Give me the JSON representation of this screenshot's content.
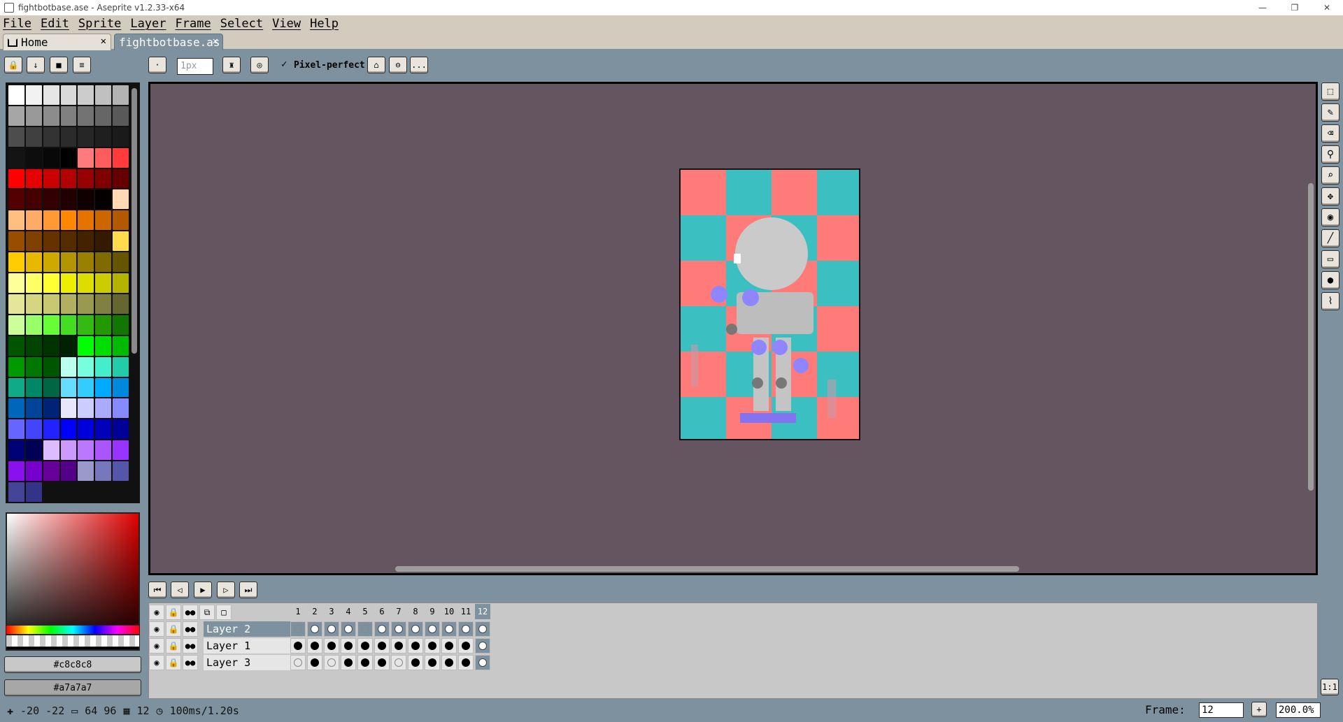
{
  "window": {
    "title": "fightbotbase.ase - Aseprite v1.2.33-x64",
    "minimize": "—",
    "restore": "❐",
    "close": "✕"
  },
  "menu": [
    "File",
    "Edit",
    "Sprite",
    "Layer",
    "Frame",
    "Select",
    "View",
    "Help"
  ],
  "tabs": {
    "home": {
      "label": "Home",
      "close": "✕"
    },
    "file": {
      "label": "fightbotbase.as",
      "close": "✕"
    }
  },
  "context_bar": {
    "brush_size": "1px",
    "pixel_perfect_label": "Pixel-perfect",
    "more": "..."
  },
  "palette": {
    "colors": [
      "#ffffff",
      "#f2f2f2",
      "#e6e6e6",
      "#d9d9d9",
      "#cccccc",
      "#c0c0c0",
      "#b3b3b3",
      "#a6a6a6",
      "#999999",
      "#8c8c8c",
      "#808080",
      "#737373",
      "#666666",
      "#595959",
      "#4d4d4d",
      "#404040",
      "#333333",
      "#2b2b2b",
      "#262626",
      "#1f1f1f",
      "#1a1a1a",
      "#141414",
      "#0d0d0d",
      "#080808",
      "#000000",
      "#ff7b7b",
      "#ff5c5c",
      "#ff3b3b",
      "#ff0000",
      "#e60000",
      "#cc0000",
      "#b30000",
      "#990000",
      "#800000",
      "#660000",
      "#550000",
      "#440000",
      "#330000",
      "#220000",
      "#110000",
      "#050000",
      "#ffd9b3",
      "#ffbf80",
      "#ffaa66",
      "#ff9933",
      "#ff8800",
      "#e67300",
      "#cc6600",
      "#b35900",
      "#994d00",
      "#804000",
      "#663300",
      "#552b00",
      "#442200",
      "#331a00",
      "#ffdb4d",
      "#ffcc00",
      "#e6b800",
      "#ccaa00",
      "#b39500",
      "#998000",
      "#806b00",
      "#665500",
      "#ffff99",
      "#ffff66",
      "#ffff33",
      "#eeee00",
      "#dddd00",
      "#cccc00",
      "#b3b300",
      "#e6e699",
      "#d6d680",
      "#c8c873",
      "#b0b060",
      "#999950",
      "#808040",
      "#666630",
      "#ccff99",
      "#99ff66",
      "#66ff33",
      "#44dd22",
      "#33bb11",
      "#229900",
      "#117700",
      "#005500",
      "#004400",
      "#003300",
      "#002200",
      "#00ff00",
      "#00dd00",
      "#00bb00",
      "#009900",
      "#007700",
      "#005500",
      "#bbffee",
      "#77ffdd",
      "#44eecc",
      "#22ccaa",
      "#11aa88",
      "#008866",
      "#006644",
      "#66ddff",
      "#33ccff",
      "#00aaff",
      "#0088dd",
      "#0066bb",
      "#004499",
      "#002277",
      "#e6e6ff",
      "#ccccff",
      "#aaaaff",
      "#8888ff",
      "#6666ff",
      "#4444ff",
      "#2222ff",
      "#0000ff",
      "#0000dd",
      "#0000bb",
      "#000099",
      "#000077",
      "#000055",
      "#ddbbff",
      "#cc99ff",
      "#bb77ff",
      "#aa55ff",
      "#9933ff",
      "#8811ee",
      "#7700cc",
      "#660099",
      "#550088",
      "#9999cc",
      "#7777bb",
      "#5555aa",
      "#444499",
      "#333388"
    ]
  },
  "colors": {
    "foreground": "#c8c8c8",
    "background": "#a7a7a7",
    "canvas_bg": "#655561",
    "checker_a": "#fe7b7a",
    "checker_b": "#3cbfc0"
  },
  "tools": [
    "marquee-icon",
    "pencil-icon",
    "eraser-icon",
    "eyedropper-icon",
    "zoom-icon",
    "move-icon",
    "bucket-icon",
    "line-icon",
    "rectangle-icon",
    "blur-icon",
    "brush-icon"
  ],
  "timeline": {
    "frames": [
      "1",
      "2",
      "3",
      "4",
      "5",
      "6",
      "7",
      "8",
      "9",
      "10",
      "11",
      "12"
    ],
    "current_frame": 12,
    "layers": [
      {
        "name": "Layer 2",
        "cels": [
          "hollow",
          "empty",
          "empty",
          "empty",
          "hollow",
          "empty",
          "empty",
          "empty",
          "empty",
          "empty",
          "empty",
          "empty"
        ]
      },
      {
        "name": "Layer 1",
        "cels": [
          "filled",
          "filled",
          "filled",
          "filled",
          "filled",
          "filled",
          "filled",
          "filled",
          "filled",
          "filled",
          "filled",
          "empty"
        ]
      },
      {
        "name": "Layer 3",
        "cels": [
          "hollow",
          "filled",
          "hollow",
          "filled",
          "filled",
          "filled",
          "hollow",
          "filled",
          "filled",
          "filled",
          "filled",
          "empty"
        ]
      }
    ]
  },
  "status": {
    "cursor": "-20 -22",
    "size": "64 96",
    "frames_count": "12",
    "duration": "100ms/1.20s",
    "frame_label": "Frame:",
    "frame_value": "12",
    "zoom": "200.0%"
  }
}
